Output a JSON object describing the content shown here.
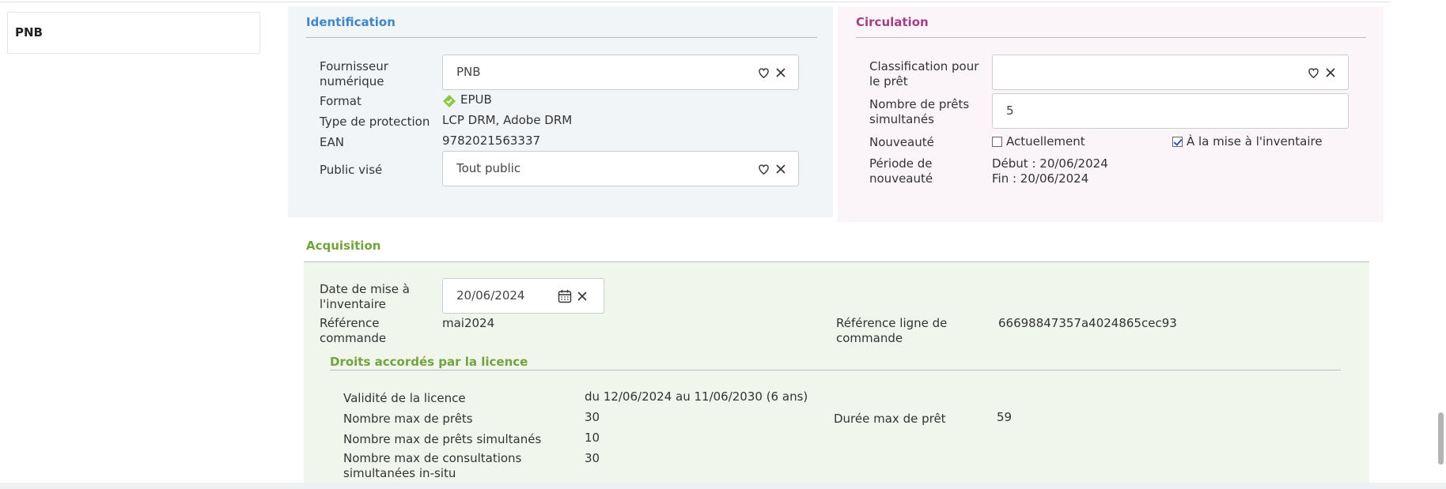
{
  "left_nav": {
    "selected_item": "PNB"
  },
  "identification": {
    "title": "Identification",
    "fournisseur_label": "Fournisseur numérique",
    "fournisseur_value": "PNB",
    "format_label": "Format",
    "format_value": "EPUB",
    "protection_label": "Type de protection",
    "protection_value": "LCP DRM, Adobe DRM",
    "ean_label": "EAN",
    "ean_value": "9782021563337",
    "public_label": "Public visé",
    "public_value": "Tout public"
  },
  "circulation": {
    "title": "Circulation",
    "classification_label": "Classification pour le prêt",
    "classification_value": "",
    "prets_simultanes_label": "Nombre de prêts simultanés",
    "prets_simultanes_value": "5",
    "nouveaute_label": "Nouveauté",
    "actuellement_label": "Actuellement",
    "actuellement_checked": false,
    "mise_inventaire_label": "À la mise à l'inventaire",
    "mise_inventaire_checked": true,
    "periode_label": "Période de nouveauté",
    "periode_debut": "Début : 20/06/2024",
    "periode_fin": "Fin : 20/06/2024"
  },
  "acquisition": {
    "title": "Acquisition",
    "date_label": "Date de mise à l'inventaire",
    "date_value": "20/06/2024",
    "ref_commande_label": "Référence commande",
    "ref_commande_value": "mai2024",
    "ref_ligne_label": "Référence ligne de commande",
    "ref_ligne_value": "66698847357a4024865cec93"
  },
  "droits": {
    "title": "Droits accordés par la licence",
    "validite_label": "Validité de la licence",
    "validite_value": "du 12/06/2024 au 11/06/2030 (6 ans)",
    "max_prets_label": "Nombre max de prêts",
    "max_prets_value": "30",
    "duree_label": "Durée max de prêt",
    "duree_value": "59",
    "max_simult_label": "Nombre max de prêts simultanés",
    "max_simult_value": "10",
    "max_consult_label": "Nombre max de consultations simultanées in-situ",
    "max_consult_value": "30"
  },
  "icons": {
    "select": "heart-shield-icon",
    "clear": "close-icon",
    "calendar": "calendar-icon",
    "format": "epub-diamond-icon"
  },
  "colors": {
    "identification": "#3f87c6",
    "circulation": "#a53f83",
    "acquisition": "#74a23e"
  }
}
